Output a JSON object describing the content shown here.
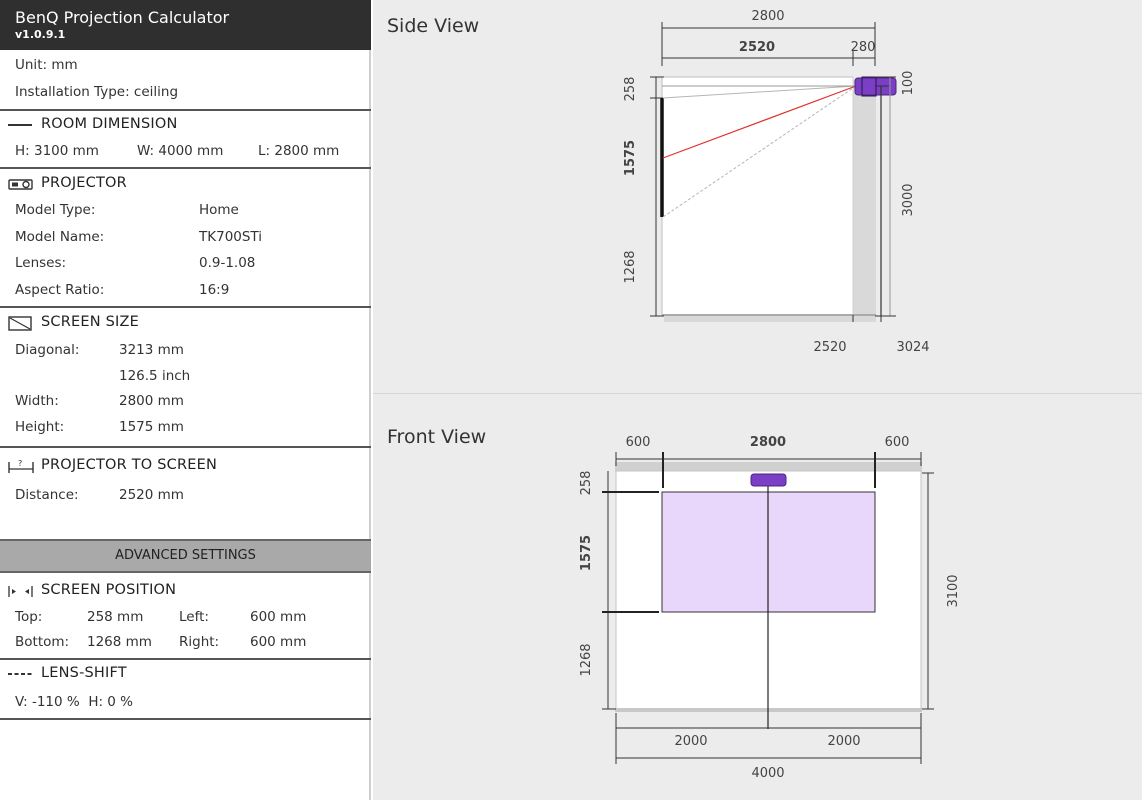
{
  "app": {
    "title": "BenQ Projection Calculator",
    "version": "v1.0.9.1"
  },
  "general": {
    "unit": "Unit: mm",
    "installation": "Installation Type: ceiling"
  },
  "room": {
    "title": "ROOM DIMENSION",
    "h": "H: 3100 mm",
    "w": "W: 4000 mm",
    "l": "L: 2800 mm"
  },
  "projector": {
    "title": "PROJECTOR",
    "rows": [
      {
        "label": "Model Type:",
        "value": "Home"
      },
      {
        "label": "Model Name:",
        "value": "TK700STi"
      },
      {
        "label": "Lenses:",
        "value": "0.9-1.08"
      },
      {
        "label": "Aspect Ratio:",
        "value": "16:9"
      }
    ]
  },
  "screen_size": {
    "title": "SCREEN SIZE",
    "diagonal_label": "Diagonal:",
    "diagonal_mm": "3213 mm",
    "diagonal_inch": "126.5 inch",
    "width_label": "Width:",
    "width_value": "2800 mm",
    "height_label": "Height:",
    "height_value": "1575 mm"
  },
  "projector_to_screen": {
    "title": "PROJECTOR TO SCREEN",
    "distance_label": "Distance:",
    "distance_value": "2520 mm"
  },
  "advanced": {
    "label": "ADVANCED SETTINGS"
  },
  "screen_position": {
    "title": "SCREEN POSITION",
    "top_label": "Top:",
    "top_value": "258 mm",
    "left_label": "Left:",
    "left_value": "600 mm",
    "bottom_label": "Bottom:",
    "bottom_value": "1268 mm",
    "right_label": "Right:",
    "right_value": "600 mm"
  },
  "lens_shift": {
    "title": "LENS-SHIFT",
    "values": "V: -110 %  H: 0 %"
  },
  "side_view": {
    "title": "Side View",
    "dim_total_top": "2800",
    "dim_throw": "2520",
    "dim_offset": "280",
    "dim_top_gap": "258",
    "dim_screen_h": "1575",
    "dim_bottom_gap": "1268",
    "dim_proj_h": "100",
    "dim_height": "3000",
    "dim_bottom_a": "2520",
    "dim_bottom_b": "3024"
  },
  "front_view": {
    "title": "Front View",
    "dim_left": "600",
    "dim_screen_w": "2800",
    "dim_right": "600",
    "dim_top_gap": "258",
    "dim_screen_h": "1575",
    "dim_bottom_gap": "1268",
    "dim_room_h": "3100",
    "dim_half_left": "2000",
    "dim_half_right": "2000",
    "dim_room_w": "4000"
  },
  "colors": {
    "header": "#2f2f2f",
    "projector": "#7a3fc4",
    "screen_fill": "#e8d7fb",
    "beam_center": "#e0322b"
  }
}
